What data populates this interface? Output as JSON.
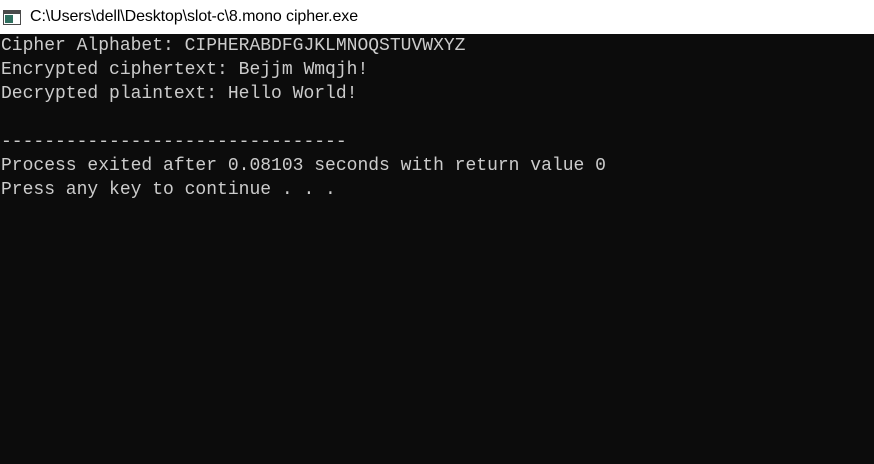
{
  "window": {
    "title": "C:\\Users\\dell\\Desktop\\slot-c\\8.mono cipher.exe",
    "icon": "console-app-icon"
  },
  "console": {
    "lines": [
      "Cipher Alphabet: CIPHERABDFGJKLMNOQSTUVWXYZ",
      "Encrypted ciphertext: Bejjm Wmqjh!",
      "Decrypted plaintext: Hello World!",
      "",
      "--------------------------------",
      "Process exited after 0.08103 seconds with return value 0",
      "Press any key to continue . . ."
    ]
  },
  "colors": {
    "background": "#0c0c0c",
    "text": "#cccccc",
    "titlebar": "#ffffff"
  }
}
